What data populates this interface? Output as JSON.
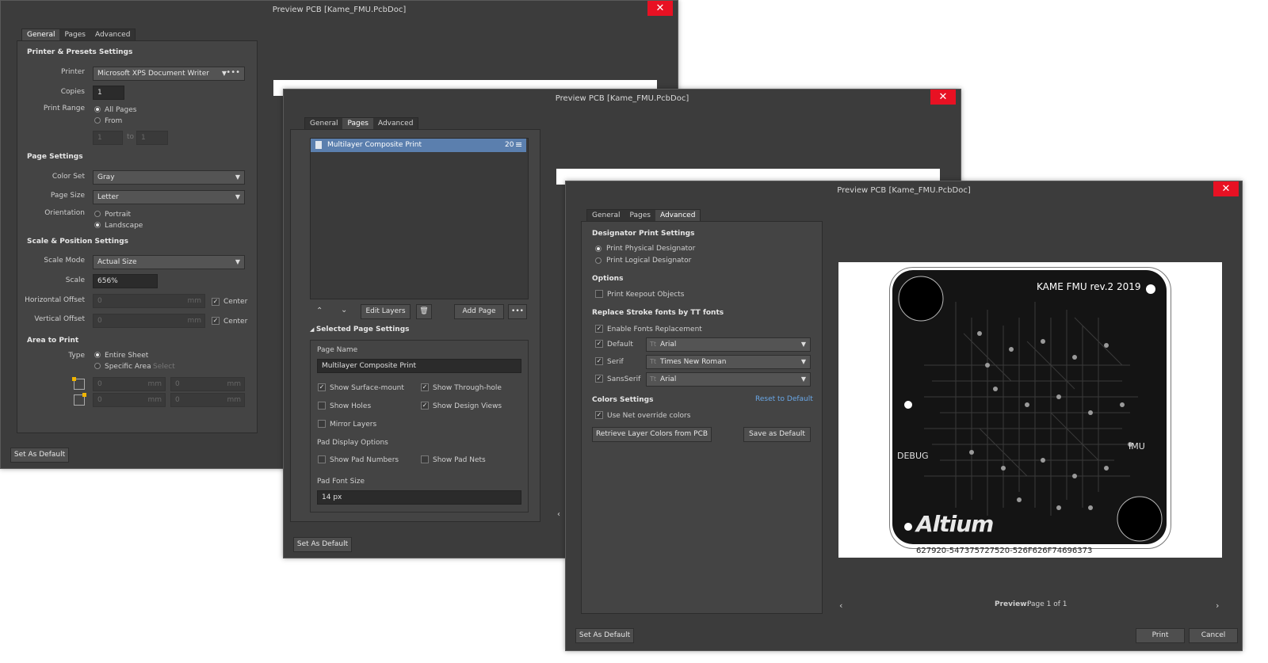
{
  "window_title": "Preview PCB [Kame_FMU.PcbDoc]",
  "close_glyph": "✕",
  "tabs": {
    "general": "General",
    "pages": "Pages",
    "advanced": "Advanced"
  },
  "set_as_default": "Set As Default",
  "general": {
    "printer_section": "Printer & Presets Settings",
    "printer_label": "Printer",
    "printer_value": "Microsoft XPS Document Writer",
    "copies_label": "Copies",
    "copies_value": "1",
    "print_range_label": "Print Range",
    "all_pages": "All Pages",
    "from": "From",
    "from_value": "1",
    "to": "to",
    "to_value": "1",
    "page_section": "Page Settings",
    "color_set_label": "Color Set",
    "color_set_value": "Gray",
    "page_size_label": "Page Size",
    "page_size_value": "Letter",
    "orientation_label": "Orientation",
    "portrait": "Portrait",
    "landscape": "Landscape",
    "scale_section": "Scale & Position Settings",
    "scale_mode_label": "Scale Mode",
    "scale_mode_value": "Actual Size",
    "scale_label": "Scale",
    "scale_value": "656%",
    "h_offset_label": "Horizontal Offset",
    "v_offset_label": "Vertical Offset",
    "offset_value": "0",
    "unit": "mm",
    "center": "Center",
    "area_section": "Area to Print",
    "type_label": "Type",
    "entire_sheet": "Entire Sheet",
    "specific_area": "Specific Area",
    "select": "Select",
    "coord_value": "0"
  },
  "pages": {
    "list_item": "Multilayer Composite Print",
    "list_count": "20",
    "edit_layers": "Edit Layers",
    "add_page": "Add Page",
    "more": "•••",
    "selected_section": "Selected Page Settings",
    "page_name_label": "Page Name",
    "page_name_value": "Multilayer Composite Print",
    "show_surface_mount": "Show Surface-mount",
    "show_through_hole": "Show Through-hole",
    "show_holes": "Show Holes",
    "show_design_views": "Show Design Views",
    "mirror_layers": "Mirror Layers",
    "pad_display_options": "Pad Display Options",
    "show_pad_numbers": "Show Pad Numbers",
    "show_pad_nets": "Show Pad Nets",
    "pad_font_size_label": "Pad Font Size",
    "pad_font_size_value": "14 px"
  },
  "advanced": {
    "designator_section": "Designator Print Settings",
    "print_physical": "Print Physical Designator",
    "print_logical": "Print Logical Designator",
    "options_section": "Options",
    "print_keepout": "Print Keepout Objects",
    "replace_section": "Replace Stroke fonts by TT fonts",
    "enable_fonts": "Enable Fonts Replacement",
    "default_label": "Default",
    "default_font": "Arial",
    "serif_label": "Serif",
    "serif_font": "Times New Roman",
    "sansserif_label": "SansSerif",
    "sansserif_font": "Arial",
    "colors_section": "Colors Settings",
    "reset_to_default": "Reset to Default",
    "use_net_override": "Use Net override colors",
    "retrieve_colors": "Retrieve Layer Colors from PCB",
    "save_as_default": "Save as Default",
    "print": "Print",
    "cancel": "Cancel"
  },
  "preview": {
    "label": "Preview:",
    "page_info": "Page 1 of 1",
    "board_title": "KAME FMU rev.2 2019",
    "debug_label": "DEBUG",
    "imu_label": "IMU",
    "logo": "Altium",
    "serial": "627920-547375727520-526F626F74696373"
  },
  "colors": {
    "close_red": "#e81123",
    "selected_item": "#5b7fae",
    "link_blue": "#6aa8e8",
    "pcb_black": "#141414"
  }
}
